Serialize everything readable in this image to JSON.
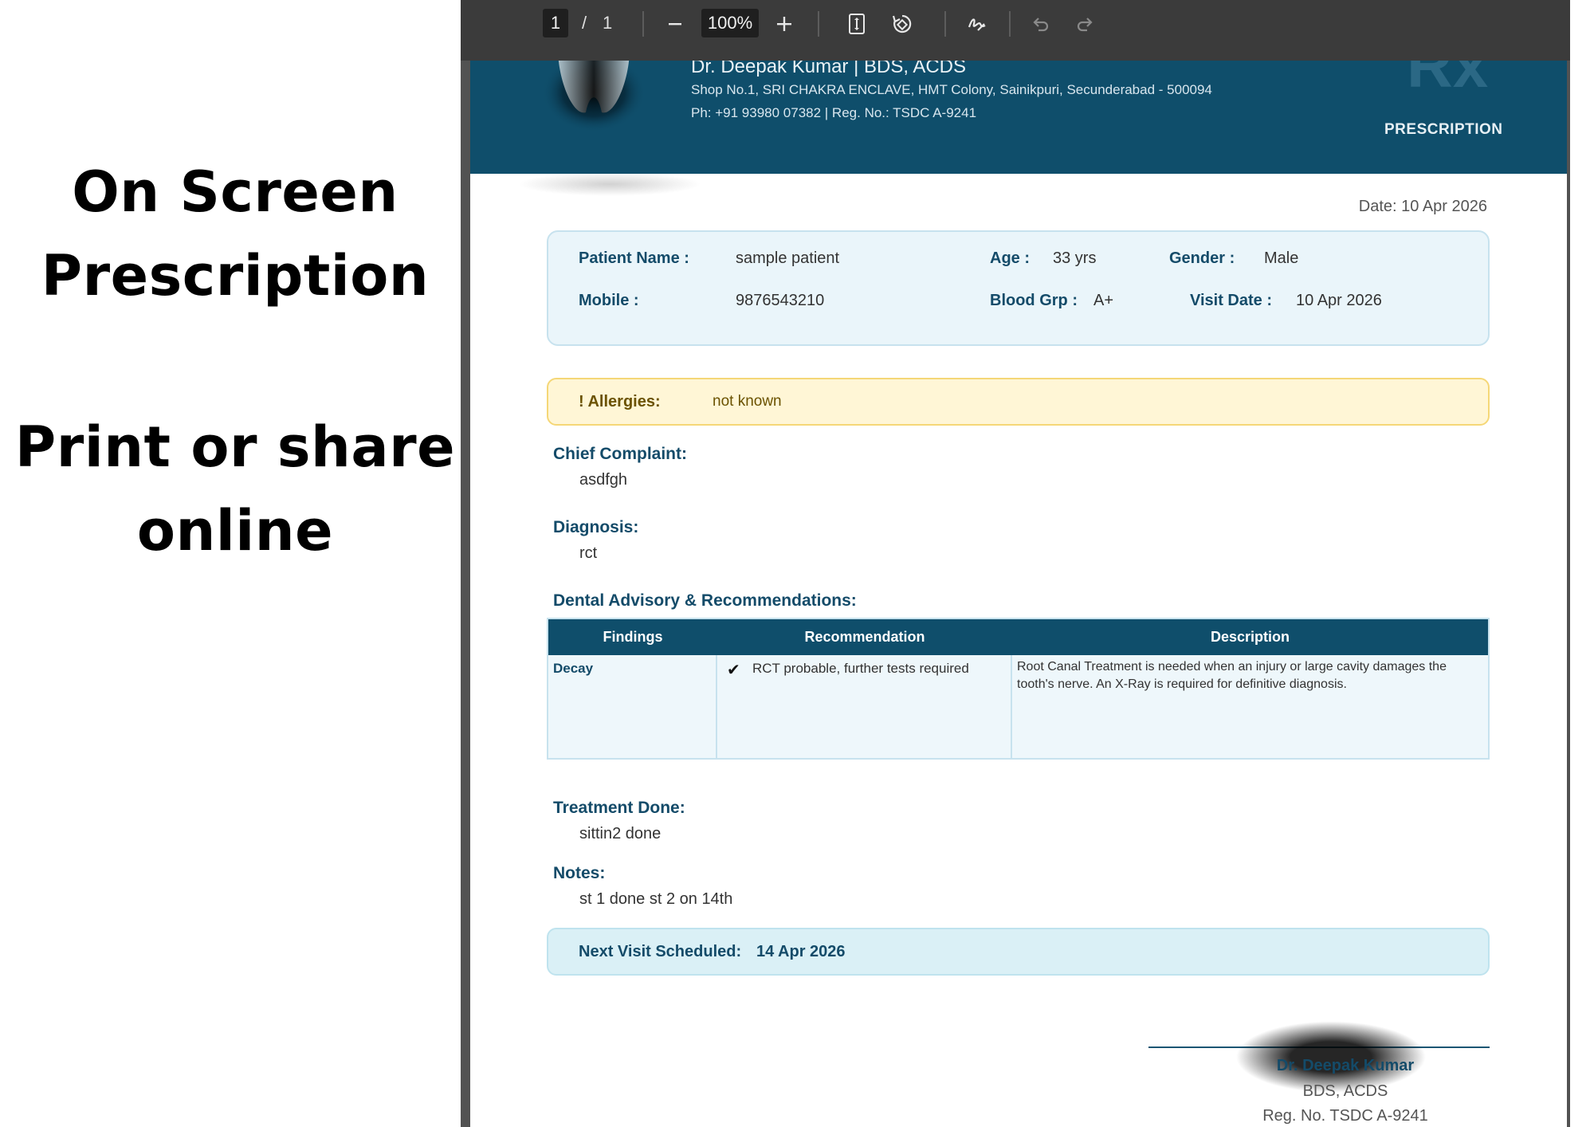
{
  "promo": {
    "line1": "On Screen",
    "line2": "Prescription",
    "line3": "Print or share",
    "line4": "online"
  },
  "toolbar": {
    "page_current": "1",
    "page_separator": "/",
    "page_total": "1",
    "zoom": "100%",
    "icons": [
      "minus-icon",
      "plus-icon",
      "fit-page-icon",
      "rotate-icon",
      "draw-icon",
      "undo-icon",
      "redo-icon"
    ]
  },
  "letterhead": {
    "doctor_line": "Dr. Deepak Kumar  |  BDS, ACDS",
    "address": "Shop No.1, SRI CHAKRA ENCLAVE, HMT Colony, Sainikpuri, Secunderabad - 500094",
    "phone_reg": "Ph: +91 93980 07382  |  Reg. No.: TSDC A-9241",
    "rx": "Rx",
    "label": "PRESCRIPTION",
    "brand_color": "#0f4e6b"
  },
  "date": "Date: 10 Apr 2026",
  "patient": {
    "name_label": "Patient Name :",
    "name": "sample patient",
    "age_label": "Age :",
    "age": "33 yrs",
    "gender_label": "Gender :",
    "gender": "Male",
    "mobile_label": "Mobile :",
    "mobile": "9876543210",
    "blood_label": "Blood Grp :",
    "blood": "A+",
    "visit_label": "Visit Date :",
    "visit": "10 Apr 2026"
  },
  "allergies": {
    "label": "! Allergies:",
    "value": "not known"
  },
  "chief_complaint": {
    "label": "Chief Complaint:",
    "value": "asdfgh"
  },
  "diagnosis": {
    "label": "Diagnosis:",
    "value": "rct"
  },
  "advisory": {
    "title": "Dental Advisory & Recommendations:",
    "headers": [
      "Findings",
      "Recommendation",
      "Description"
    ],
    "rows": [
      {
        "finding": "Decay",
        "check": "✔",
        "recommendation": "RCT probable, further tests required",
        "description_line1": "Root Canal Treatment is needed when an injury or large cavity damages the",
        "description_line2": "tooth's nerve. An X-Ray is required for definitive diagnosis."
      }
    ]
  },
  "treatment": {
    "label": "Treatment Done:",
    "value": "sittin2 done"
  },
  "notes": {
    "label": "Notes:",
    "value": "st 1 done st 2 on 14th"
  },
  "next_visit": {
    "label": "Next Visit Scheduled:",
    "value": "14 Apr 2026"
  },
  "signature": {
    "name": "Dr. Deepak Kumar",
    "degree": "BDS, ACDS",
    "reg": "Reg. No. TSDC A-9241"
  }
}
